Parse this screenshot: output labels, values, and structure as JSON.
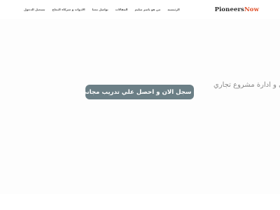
{
  "header": {
    "logo_main": "Pioneers",
    "logo_accent": "Now",
    "nav": [
      "تسجيل الدخول",
      "الادوات و شركاء النجاح",
      "تواصل معنا",
      "المقالات",
      "من هو باسر سليم",
      "الرئيسيه"
    ]
  },
  "hero": {
    "text": "ى و ادارة مشروع تجاري",
    "cta_label": "سجل الان و احصل علي تدريب مجاني",
    "cta_icon": "double-chevron-icon",
    "cta_arrow": "»"
  },
  "colors": {
    "cta_bg": "#6b7f86",
    "logo_accent": "#e0502a"
  }
}
